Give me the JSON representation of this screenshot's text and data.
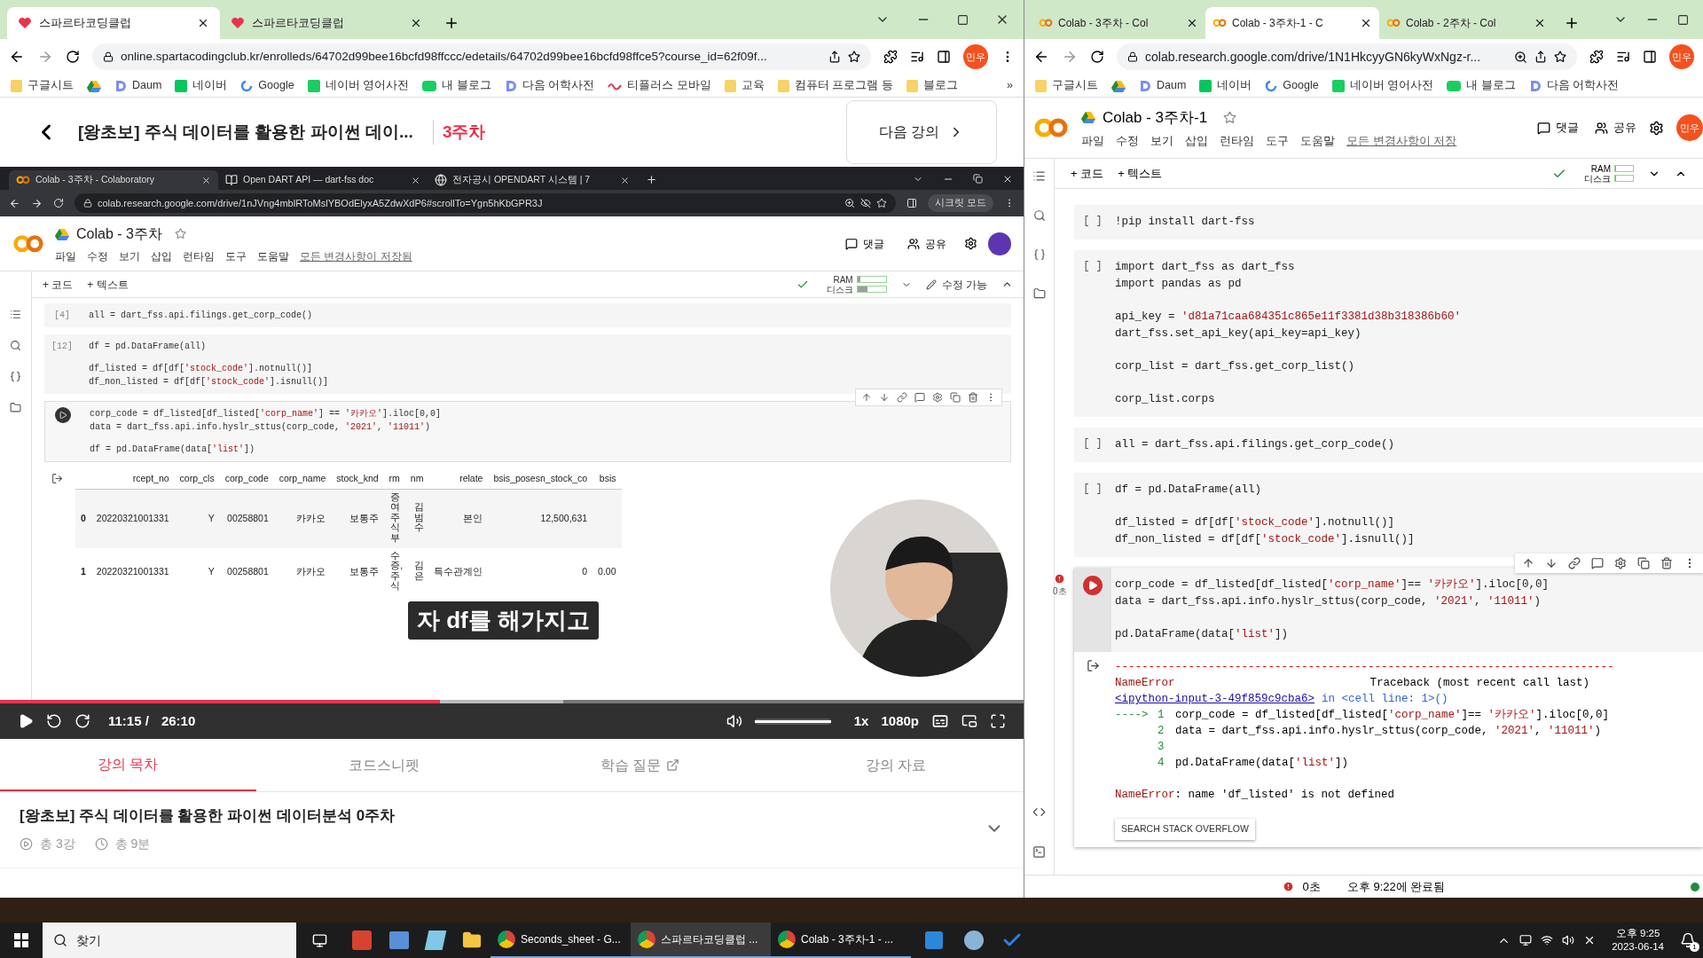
{
  "left_window": {
    "tabs": [
      {
        "title": "스파르타코딩클럽",
        "kind": "heart",
        "selected": true
      },
      {
        "title": "스파르타코딩클럽",
        "kind": "heart",
        "selected": false
      }
    ],
    "url": "online.spartacodingclub.kr/enrolleds/64702d99bee16bcfd98ffccc/edetails/64702d99bee16bcfd98ffce5?course_id=62f09f...",
    "profile": "민우",
    "bookmarks": [
      {
        "label": "구글시트",
        "kind": "folder"
      },
      {
        "kind": "drive"
      },
      {
        "label": "Daum",
        "kind": "d"
      },
      {
        "label": "네이버",
        "kind": "square",
        "color": "#03c75a"
      },
      {
        "label": "Google",
        "kind": "g"
      },
      {
        "label": "네이버 영어사전",
        "kind": "square",
        "color": "#19ce60"
      },
      {
        "label": "내 블로그",
        "kind": "blog"
      },
      {
        "label": "다음 어학사전",
        "kind": "d"
      },
      {
        "label": "티플러스 모바일",
        "kind": "wave"
      },
      {
        "label": "교육",
        "kind": "folder"
      },
      {
        "label": "컴퓨터 프로그램 등",
        "kind": "folder"
      },
      {
        "label": "블로그",
        "kind": "folder"
      }
    ],
    "more": "»",
    "lecture": {
      "title": "[왕초보] 주식 데이터를 활용한 파이썬 데이...",
      "week": "3주차",
      "next": "다음 강의"
    },
    "video": {
      "browser": {
        "tabs": [
          {
            "title": "Colab - 3주차 - Colaboratory",
            "kind": "colab",
            "selected": true
          },
          {
            "title": "Open DART API — dart-fss doc",
            "kind": "book",
            "selected": false
          },
          {
            "title": "전자공시 OPENDART 시스템 | 7",
            "kind": "globe",
            "selected": false
          }
        ],
        "url": "colab.research.google.com/drive/1nJVng4mblRToMslYBOdElyxA5ZdwXdP6#scrollTo=Ygn5hKbGPR3J",
        "incognito": "시크릿 모드"
      },
      "colab": {
        "title": "Colab - 3주차",
        "menus": [
          "파일",
          "수정",
          "보기",
          "삽입",
          "런타임",
          "도구",
          "도움말"
        ],
        "saved": "모든 변경사항이 저장됨",
        "comment": "댓글",
        "share": "공유",
        "add_code": "+ 코드",
        "add_text": "+ 텍스트",
        "ram": {
          "label": "RAM",
          "level": 0.1
        },
        "disk": {
          "label": "디스크",
          "level": 0.35
        },
        "edit": "수정 가능",
        "cells": [
          {
            "kind": "done",
            "exec": "[4]",
            "blocks": [
              [
                "all = dart_fss.api.filings.get_corp_code()"
              ]
            ]
          },
          {
            "kind": "done",
            "exec": "[12]",
            "blocks": [
              [
                "df = pd.DataFrame(all)"
              ],
              [
                "df_listed = df[df['stock_code'].notnull()]",
                "df_non_listed = df[df['stock_code'].isnull()]"
              ]
            ]
          },
          {
            "kind": "run",
            "blocks": [
              [
                "corp_code = df_listed[df_listed['corp_name'] == '카카오'].iloc[0,0]",
                "data = dart_fss.api.info.hyslr_sttus(corp_code, '2021', '11011')"
              ],
              [
                "df = pd.DataFrame(data['list'])"
              ]
            ]
          }
        ],
        "table": {
          "columns": [
            {
              "label": "rcept_no",
              "vertical": false
            },
            {
              "label": "corp_cls",
              "vertical": false
            },
            {
              "label": "corp_code",
              "vertical": false
            },
            {
              "label": "corp_name",
              "vertical": false
            },
            {
              "label": "stock_knd",
              "vertical": false
            },
            {
              "label": "rm",
              "vertical": true
            },
            {
              "label": "nm",
              "vertical": true
            },
            {
              "label": "relate",
              "vertical": false
            },
            {
              "label": "bsis_posesn_stock_co",
              "vertical": false
            },
            {
              "label": "bsis",
              "vertical": false
            }
          ],
          "rows": [
            {
              "index": "0",
              "cells": [
                "20220321001331",
                "Y",
                "00258801",
                "카카오",
                "보통주",
                "증여주식부",
                "김범수",
                "본인",
                "12,500,631"
              ]
            },
            {
              "index": "1",
              "cells": [
                "20220321001331",
                "Y",
                "00258801",
                "카카오",
                "보통주",
                "수증,주식",
                "김은",
                "특수관계인",
                "0",
                "0.00"
              ]
            }
          ]
        }
      },
      "subtitle": "자 df를 해가지고",
      "progress": {
        "level": 0.43
      },
      "buffer": {
        "level": 0.55
      },
      "time": "11:15 /",
      "duration": "26:10",
      "volume": {
        "level": 1
      },
      "speed": "1x",
      "quality": "1080p"
    },
    "lecture_tabs": [
      {
        "label": "강의 목차",
        "selected": true,
        "external": false
      },
      {
        "label": "코드스니펫",
        "selected": false,
        "external": false
      },
      {
        "label": "학습 질문",
        "selected": false,
        "external": true
      },
      {
        "label": "강의 자료",
        "selected": false,
        "external": false
      }
    ],
    "course": {
      "title": "[왕초보] 주식 데이터를 활용한 파이썬 데이터분석 0주차",
      "lessons": "총 3강",
      "duration": "총 9분",
      "expanded": false
    }
  },
  "right_window": {
    "tabs": [
      {
        "title": "Colab - 3주차 - Col",
        "kind": "colab",
        "selected": false
      },
      {
        "title": "Colab - 3주차-1 - C",
        "kind": "colab",
        "selected": true
      },
      {
        "title": "Colab - 2주차 - Col",
        "kind": "colab",
        "selected": false
      }
    ],
    "url": "colab.research.google.com/drive/1N1HkcyyGN6kyWxNgz-r...",
    "profile": "민우",
    "bookmarks": [
      {
        "label": "구글시트",
        "kind": "folder"
      },
      {
        "kind": "drive"
      },
      {
        "label": "Daum",
        "kind": "d"
      },
      {
        "label": "네이버",
        "kind": "square",
        "color": "#03c75a"
      },
      {
        "label": "Google",
        "kind": "g"
      },
      {
        "label": "네이버 영어사전",
        "kind": "square",
        "color": "#19ce60"
      },
      {
        "label": "내 블로그",
        "kind": "blog"
      },
      {
        "label": "다음 어학사전",
        "kind": "d"
      }
    ],
    "colab": {
      "title": "Colab - 3주차-1",
      "menus": [
        "파일",
        "수정",
        "보기",
        "삽입",
        "런타임",
        "도구",
        "도움말"
      ],
      "saved": "모든 변경사항이 저장",
      "comment": "댓글",
      "share": "공유",
      "avatar": "민우",
      "add_code": "+ 코드",
      "add_text": "+ 텍스트",
      "ram": {
        "label": "RAM",
        "level": 0.05
      },
      "disk": {
        "label": "디스크",
        "level": 0.05
      },
      "cells": [
        {
          "kind": "idle",
          "exec": "[ ]",
          "blocks": [
            [
              "!pip install dart-fss"
            ]
          ]
        },
        {
          "kind": "idle",
          "exec": "[ ]",
          "blocks": [
            [
              "import dart_fss as dart_fss",
              "import pandas as pd"
            ],
            [
              "api_key = 'd81a71caa684351c865e11f3381d38b318386b60'",
              "dart_fss.set_api_key(api_key=api_key)"
            ],
            [
              "corp_list = dart_fss.get_corp_list()"
            ],
            [
              "corp_list.corps"
            ]
          ]
        },
        {
          "kind": "idle",
          "exec": "[ ]",
          "blocks": [
            [
              "all = dart_fss.api.filings.get_corp_code()"
            ]
          ]
        },
        {
          "kind": "idle",
          "exec": "[ ]",
          "blocks": [
            [
              "df = pd.DataFrame(all)"
            ],
            [
              "df_listed = df[df['stock_code'].notnull()]",
              "df_non_listed = df[df['stock_code'].isnull()]"
            ]
          ]
        },
        {
          "kind": "error",
          "time": "0초",
          "blocks": [
            [
              "corp_code = df_listed[df_listed['corp_name']== '카카오'].iloc[0,0]",
              "data = dart_fss.api.info.hyslr_sttus(corp_code, '2021', '11011')"
            ],
            [
              "pd.DataFrame(data['list'])"
            ]
          ],
          "output": [
            {
              "kind": "rule",
              "text": "---------------------------------------------------------------------------"
            },
            {
              "kind": "head",
              "name": "NameError",
              "text": "Traceback (most recent call last)"
            },
            {
              "kind": "link",
              "link": "<ipython-input-3-49f859c9cba6>",
              "text": "in <cell line: 1>()"
            },
            {
              "kind": "frame",
              "marker": "---->",
              "num": "1",
              "code": "corp_code = df_listed[df_listed['corp_name']== '카카오'].iloc[0,0]"
            },
            {
              "kind": "frame",
              "num": "2",
              "code": "data = dart_fss.api.info.hyslr_sttus(corp_code, '2021', '11011')"
            },
            {
              "kind": "frame",
              "num": "3"
            },
            {
              "kind": "frame",
              "num": "4",
              "code": "pd.DataFrame(data['list'])"
            },
            {
              "kind": "message",
              "name": "NameError",
              "text": ": name 'df_listed' is not defined"
            }
          ],
          "button": "SEARCH STACK OVERFLOW"
        }
      ],
      "status": {
        "time": "0초",
        "text": "오후 9:22에 완료됨"
      }
    }
  },
  "taskbar": {
    "search": "찾기",
    "apps": [
      {
        "label": "Seconds_sheet - G...",
        "selected": false
      },
      {
        "label": "스파르타코딩클럽 ...",
        "selected": true
      },
      {
        "label": "Colab - 3주차-1 - ...",
        "selected": false
      }
    ],
    "time": "오후 9:25",
    "date": "2023-06-14",
    "notifications": "1"
  }
}
